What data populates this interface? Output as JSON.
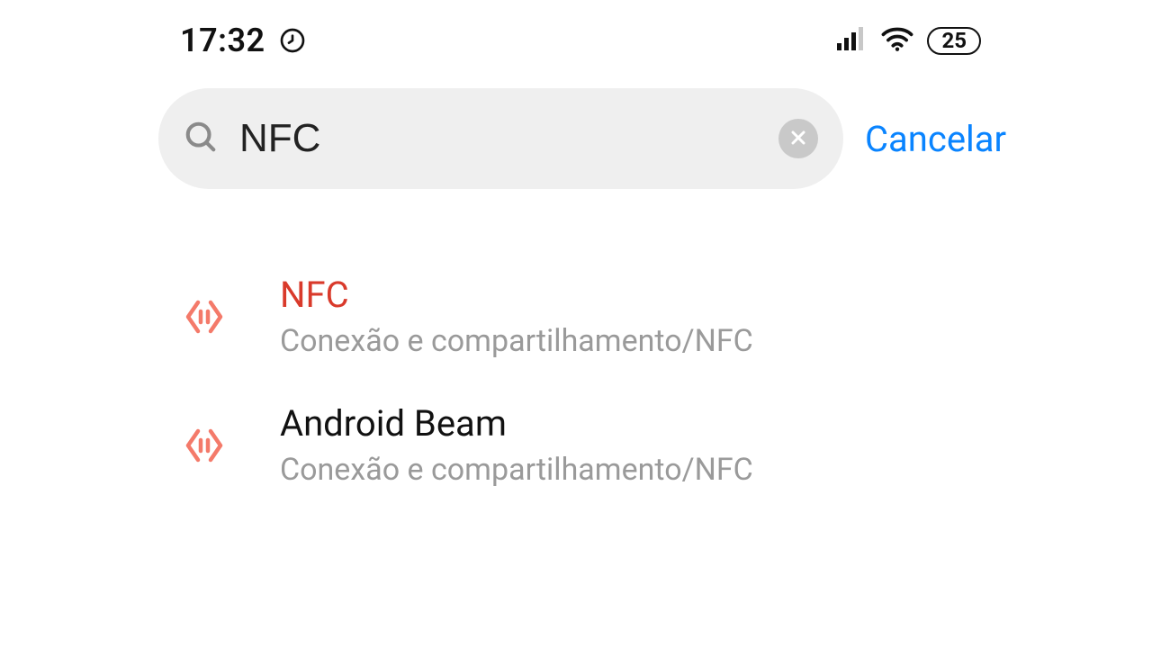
{
  "status_bar": {
    "time": "17:32",
    "battery_percent": "25"
  },
  "search": {
    "value": "NFC",
    "cancel_label": "Cancelar"
  },
  "results": [
    {
      "title": "NFC",
      "subtitle": "Conexão e compartilhamento/NFC",
      "highlight": true
    },
    {
      "title": "Android Beam",
      "subtitle": "Conexão e compartilhamento/NFC",
      "highlight": false
    }
  ],
  "colors": {
    "accent_blue": "#0a84ff",
    "highlight_red": "#d93a2b",
    "icon_coral": "#f47a6a"
  }
}
